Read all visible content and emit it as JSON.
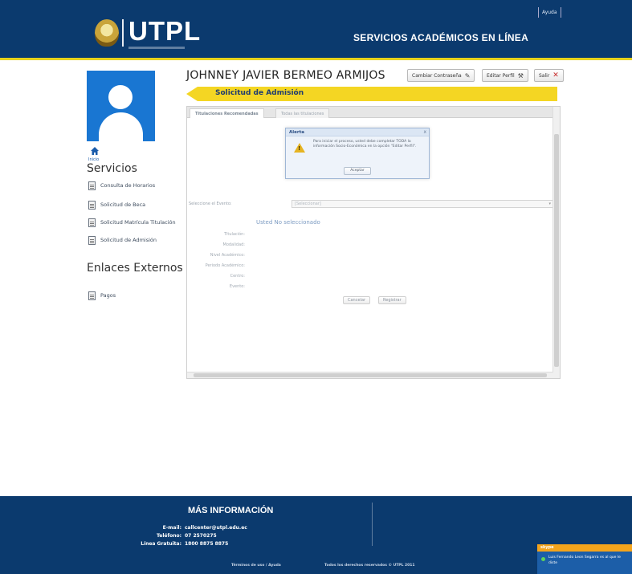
{
  "header": {
    "logo_text": "UTPL",
    "tagline": "SERVICIOS ACADÉMICOS EN LÍNEA",
    "help_link": "Ayuda",
    "brand_color": "#0b3a6e",
    "accent_color": "#e8d21c"
  },
  "sidebar": {
    "home_label": "Inicio",
    "services_title": "Servicios",
    "services": [
      {
        "label": "Consulta de Horarios",
        "icon": "document-icon"
      },
      {
        "label": "Solicitud de Beca",
        "icon": "document-icon"
      },
      {
        "label": "Solicitud Matrícula Titulación",
        "icon": "document-icon"
      },
      {
        "label": "Solicitud de Admisión",
        "icon": "document-icon"
      }
    ],
    "external_title": "Enlaces Externos",
    "external": [
      {
        "label": "Pagos",
        "icon": "document-icon"
      }
    ]
  },
  "main": {
    "user_name": "JOHNNEY JAVIER BERMEO ARMIJOS",
    "buttons": {
      "change_password": "Cambiar Contraseña",
      "edit_profile": "Editar Perfil",
      "exit": "Salir"
    },
    "banner_title": "Solicitud de Admisión",
    "tabs": [
      {
        "label": "Titulaciones Recomendadas",
        "active": true
      },
      {
        "label": "Todas las titulaciones",
        "active": false
      }
    ],
    "alert": {
      "title": "Alerta",
      "close": "x",
      "message": "Para iniciar el proceso, usted debe completar TODA la información Socio-Económica en la opción \"Editar Perfil\".",
      "ok_label": "Aceptar"
    },
    "event_label": "Seleccione el Evento:",
    "event_placeholder": "[Seleccionar]",
    "no_selection": "Usted No seleccionado",
    "fields": [
      "Titulación:",
      "Modalidad:",
      "Nivel Académico:",
      "Periodo Académico:",
      "Centro:",
      "Evento:"
    ],
    "form_buttons": {
      "cancel": "Cancelar",
      "register": "Registrar"
    }
  },
  "footer": {
    "title": "MÁS INFORMACIÓN",
    "rows": [
      {
        "key": "E-mail:",
        "value": "callcenter@utpl.edu.ec"
      },
      {
        "key": "Teléfono:",
        "value": "07 2570275"
      },
      {
        "key": "Línea Gratuita:",
        "value": "1800 8875 8875"
      }
    ],
    "terms": "Términos de uso / Ayuda",
    "rights": "Todos los derechos reservados © UTPL 2011"
  },
  "chat": {
    "brand": "skype",
    "status_color": "#5fd35a",
    "text": "Luis Fernando Leon Segarra es al que le diste"
  }
}
